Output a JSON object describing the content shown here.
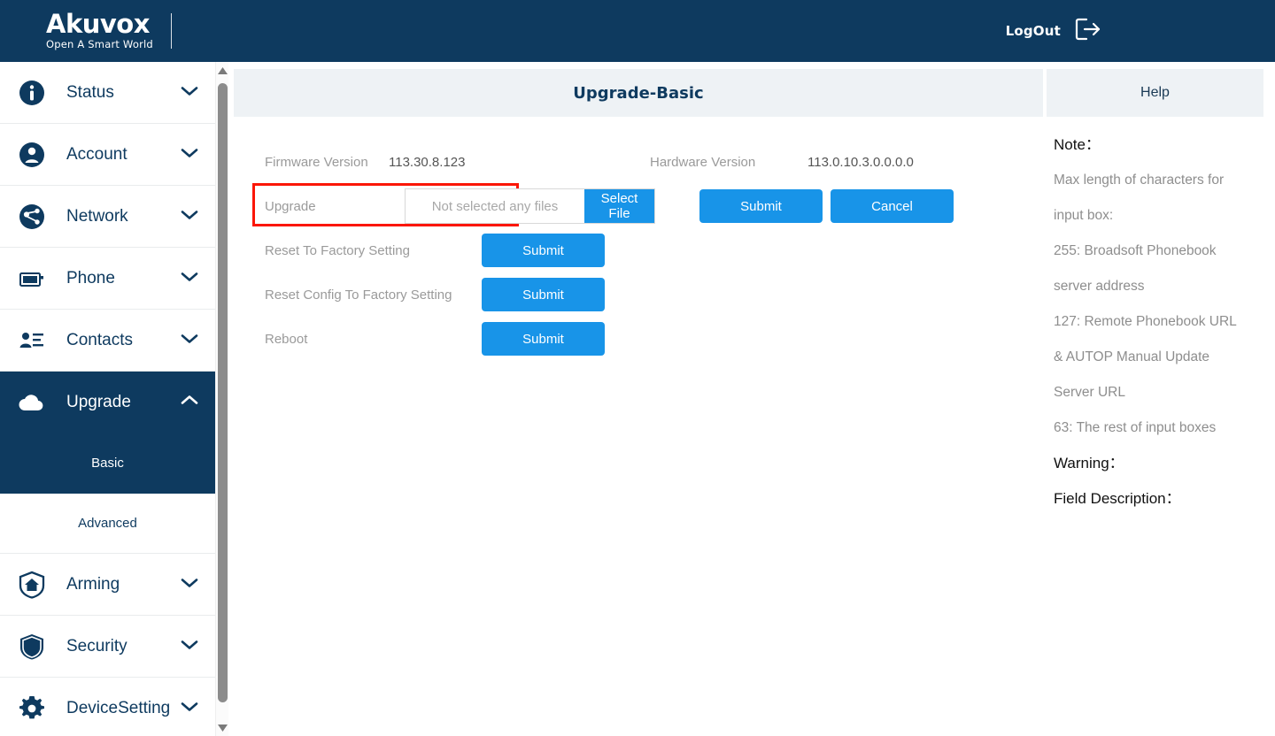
{
  "topbar": {
    "logo_main": "Akuvox",
    "logo_sub": "Open A Smart World",
    "logout_label": "LogOut",
    "logout_icon": "logout-arrow-icon",
    "background_color": "#0e3a5f"
  },
  "sidebar": {
    "items": [
      {
        "label": "Status",
        "icon": "info-circle-icon",
        "chevron": "chevron-down-icon",
        "active": false
      },
      {
        "label": "Account",
        "icon": "user-circle-icon",
        "chevron": "chevron-down-icon",
        "active": false
      },
      {
        "label": "Network",
        "icon": "network-share-icon",
        "chevron": "chevron-down-icon",
        "active": false
      },
      {
        "label": "Phone",
        "icon": "phone-screen-icon",
        "chevron": "chevron-down-icon",
        "active": false
      },
      {
        "label": "Contacts",
        "icon": "contacts-list-icon",
        "chevron": "chevron-down-icon",
        "active": false
      },
      {
        "label": "Upgrade",
        "icon": "cloud-upload-icon",
        "chevron": "chevron-up-icon",
        "active": true
      },
      {
        "label": "Arming",
        "icon": "home-shield-icon",
        "chevron": "chevron-down-icon",
        "active": false
      },
      {
        "label": "Security",
        "icon": "shield-icon",
        "chevron": "chevron-down-icon",
        "active": false
      },
      {
        "label": "DeviceSetting",
        "icon": "gear-icon",
        "chevron": "chevron-down-icon",
        "active": false
      }
    ],
    "subitems": [
      {
        "label": "Basic",
        "active": true
      },
      {
        "label": "Advanced",
        "active": false
      }
    ],
    "scrollbar": {
      "up_icon": "scroll-up-arrow-icon",
      "down_icon": "scroll-down-arrow-icon"
    }
  },
  "main": {
    "title": "Upgrade-Basic",
    "firmware_label": "Firmware Version",
    "firmware_value": "113.30.8.123",
    "hardware_label": "Hardware Version",
    "hardware_value": "113.0.10.3.0.0.0.0",
    "upgrade_label": "Upgrade",
    "file_placeholder": "Not selected any files",
    "select_file_label": "Select File",
    "submit_label": "Submit",
    "cancel_label": "Cancel",
    "reset_factory_label": "Reset To Factory Setting",
    "reset_factory_button": "Submit",
    "reset_config_label": "Reset Config To Factory Setting",
    "reset_config_button": "Submit",
    "reboot_label": "Reboot",
    "reboot_button": "Submit",
    "highlight_color": "#fb1605",
    "accent_color": "#1894e8"
  },
  "help": {
    "title": "Help",
    "note_heading": "Note：",
    "lines": [
      "Max length of characters for",
      "input box:",
      "255: Broadsoft Phonebook",
      "server address",
      "127: Remote Phonebook URL",
      "& AUTOP Manual Update",
      "Server URL",
      "63: The rest of input boxes"
    ],
    "warning_heading": "Warning：",
    "field_description_heading": "Field Description："
  }
}
